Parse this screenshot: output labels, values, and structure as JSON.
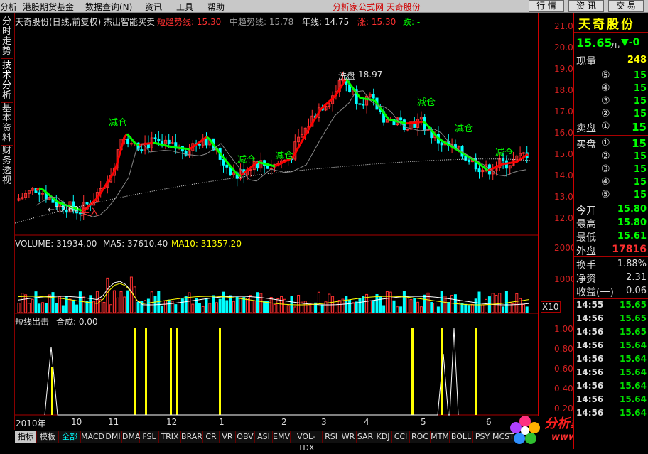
{
  "menu": {
    "items": [
      "分析",
      "港股期货基金",
      "数据查询(N)",
      "资讯",
      "工具",
      "帮助"
    ],
    "center": "分析家公式网  天奇股份",
    "buttons": [
      "行 情",
      "资 讯",
      "交 易"
    ]
  },
  "left_tabs": [
    "分时走势",
    "技术分析",
    "基本资料",
    "财务透视"
  ],
  "header": {
    "title": "天奇股份(日线,前复权) 杰出智能买卖",
    "short_trend": "短趋势线: 15.30",
    "mid_trend": "中趋势线: 15.78",
    "year_line": "年线: 14.75",
    "rise": "涨: 15.30",
    "fall": "跌: -"
  },
  "price_axis": [
    "21.00",
    "20.00",
    "19.00",
    "18.00",
    "17.00",
    "16.00",
    "15.00",
    "14.00",
    "13.00",
    "12.00"
  ],
  "annotations": {
    "low": "←12.62",
    "buy": "买入",
    "high": "18.97",
    "wash": "洗盘",
    "reduce": "减仓",
    "add": "减仓"
  },
  "volume_header": {
    "volume": "VOLUME: 31934.00",
    "ma5": "MA5: 37610.40",
    "ma10": "MA10: 31357.20"
  },
  "volume_axis": [
    "20000",
    "10000"
  ],
  "volume_unit": "X10",
  "signal_header": {
    "title": "短线出击",
    "combined": "合成: 0.00"
  },
  "signal_axis": [
    "1.00",
    "0.80",
    "0.60",
    "0.40",
    "0.20"
  ],
  "x_dates": [
    "2010年",
    "10",
    "11",
    "12",
    "1",
    "2",
    "3",
    "4",
    "5",
    "6"
  ],
  "bottom_tabs": [
    "指标",
    "模板",
    "全部",
    "MACD",
    "DMI",
    "DMA",
    "FSL",
    "TRIX",
    "BRAR",
    "CR",
    "VR",
    "OBV",
    "ASI",
    "EMV",
    "VOL-TDX",
    "RSI",
    "WR",
    "SAR",
    "KDJ",
    "CCI",
    "ROC",
    "MTM",
    "BOLL",
    "PSY",
    "MCST"
  ],
  "quote": {
    "name": "天奇股份",
    "price": "15.65",
    "unit": "元",
    "change": "▼-0",
    "now_hand_label": "现量",
    "now_hand": "248",
    "sell_label": "卖盘",
    "buy_label": "买盘",
    "levels": [
      "⑤",
      "④",
      "③",
      "②",
      "①"
    ],
    "sell_prices": [
      "15",
      "15",
      "15",
      "15",
      "15"
    ],
    "buy_levels": [
      "①",
      "②",
      "③",
      "④",
      "⑤"
    ],
    "buy_prices": [
      "15",
      "15",
      "15",
      "15",
      "15"
    ],
    "open_label": "今开",
    "open": "15.80",
    "high_label": "最高",
    "high": "15.80",
    "low_label": "最低",
    "low": "15.61",
    "outer_label": "外盘",
    "outer": "17816",
    "turnover_label": "换手",
    "turnover": "1.88%",
    "nav_label": "净资",
    "nav": "2.31",
    "eps_label": "收益(一)",
    "eps": "0.06"
  },
  "ticks": [
    {
      "time": "14:55",
      "price": "15.65"
    },
    {
      "time": "14:56",
      "price": "15.65"
    },
    {
      "time": "14:56",
      "price": "15.65"
    },
    {
      "time": "14:56",
      "price": "15.64"
    },
    {
      "time": "14:56",
      "price": "15.64"
    },
    {
      "time": "14:56",
      "price": "15.64"
    },
    {
      "time": "14:56",
      "price": "15.64"
    },
    {
      "time": "14:56",
      "price": "15.64"
    },
    {
      "time": "14:56",
      "price": "15.64"
    }
  ],
  "watermark": {
    "title": "分析家公式网",
    "url": "www.88gs.com"
  },
  "colors": {
    "up": "#ff3030",
    "down": "#00ffff",
    "trend_up": "#ff0000",
    "trend_down": "#00ff00",
    "signal": "#ffff00"
  }
}
